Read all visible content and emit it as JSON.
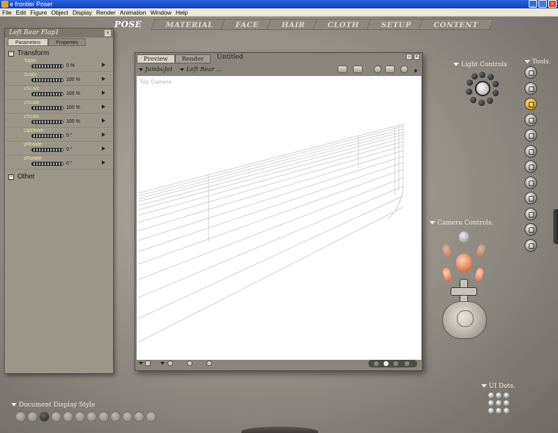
{
  "window": {
    "title": "e frontier Poser",
    "buttons": [
      "_",
      "□",
      "×"
    ]
  },
  "menu": [
    "File",
    "Edit",
    "Figure",
    "Object",
    "Display",
    "Render",
    "Animation",
    "Window",
    "Help"
  ],
  "rooms": [
    "POSE",
    "MATERIAL",
    "FACE",
    "HAIR",
    "CLOTH",
    "SETUP",
    "CONTENT"
  ],
  "param_panel": {
    "title": "Left Rear Flap1",
    "tabs": [
      "Parameters",
      "Properties"
    ],
    "groups": {
      "transform": "Transform",
      "other": "Other"
    },
    "params": [
      {
        "name": "Taper",
        "value": "0 %"
      },
      {
        "name": "Scale",
        "value": "100 %"
      },
      {
        "name": "xScale",
        "value": "100 %"
      },
      {
        "name": "yScale",
        "value": "100 %"
      },
      {
        "name": "zScale",
        "value": "100 %"
      },
      {
        "name": "UpDown",
        "value": "0 °"
      },
      {
        "name": "yRotate",
        "value": "0 °"
      },
      {
        "name": "zRotate",
        "value": "0 °"
      }
    ],
    "name_colors": [
      "#e0e0a0",
      "#b8e8a0",
      "#b8e8a0",
      "#b8e8a0",
      "#b8e8a0",
      "#e8e8a0",
      "#e8e8a0",
      "#e8e8a0"
    ]
  },
  "doc_window": {
    "tabs": [
      "Preview",
      "Render"
    ],
    "title": "Untitled",
    "figure_menu": "JumboJet",
    "actor_menu": "Left Rear ...",
    "camera_label": "Top Camera"
  },
  "labels": {
    "light_controls": "Light Controls",
    "tools": "Tools",
    "camera_controls": "Camera Controls",
    "ui_dots": "UI Dots",
    "doc_display_style": "Document Display Style"
  },
  "colors": {
    "active_tool": "#e0a020",
    "panel_bg": "#9c968a"
  }
}
